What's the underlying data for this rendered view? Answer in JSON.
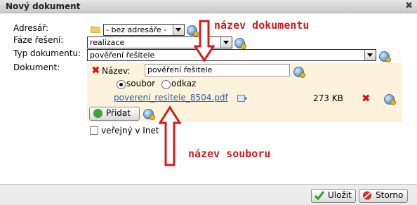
{
  "dialog": {
    "title": "Nový dokument"
  },
  "form": {
    "adresar_label": "Adresář:",
    "adresar_value": "- bez adresáře -",
    "faze_label": "Fáze řešení:",
    "faze_value": "realizace",
    "typ_label": "Typ dokumentu:",
    "typ_value": "pověření řešitele",
    "dokument_label": "Dokument:"
  },
  "document": {
    "nazev_label": "Název:",
    "nazev_value": "pověření řešitele",
    "soubor_label": "soubor",
    "odkaz_label": "odkaz",
    "selected_source": "soubor",
    "file_name": "povereni_resitele_8504.pdf",
    "file_size": "273 KB",
    "pridat_label": "Přidat"
  },
  "public_checkbox": {
    "label": "veřejný v Inet",
    "checked": false
  },
  "annotations": {
    "doc_name": "název dokumentu",
    "file_name": "název souboru"
  },
  "buttons": {
    "save": "Uložit",
    "cancel": "Storno"
  },
  "colors": {
    "annotation": "#d41b1b",
    "panel": "#fdf3dc",
    "link": "#2a5ea8"
  }
}
